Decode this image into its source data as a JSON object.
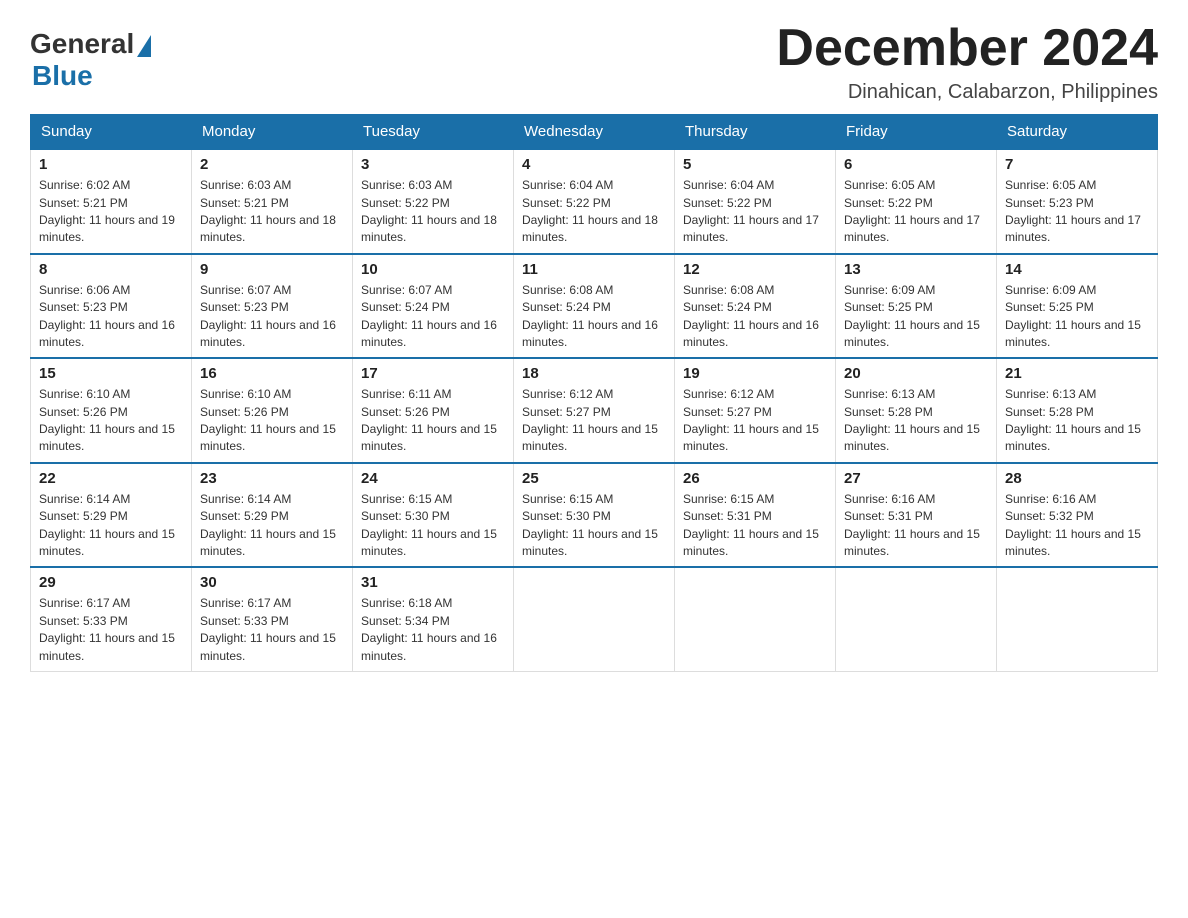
{
  "logo": {
    "general": "General",
    "blue": "Blue"
  },
  "header": {
    "month": "December 2024",
    "location": "Dinahican, Calabarzon, Philippines"
  },
  "days_of_week": [
    "Sunday",
    "Monday",
    "Tuesday",
    "Wednesday",
    "Thursday",
    "Friday",
    "Saturday"
  ],
  "weeks": [
    [
      {
        "day": "1",
        "sunrise": "6:02 AM",
        "sunset": "5:21 PM",
        "daylight": "11 hours and 19 minutes."
      },
      {
        "day": "2",
        "sunrise": "6:03 AM",
        "sunset": "5:21 PM",
        "daylight": "11 hours and 18 minutes."
      },
      {
        "day": "3",
        "sunrise": "6:03 AM",
        "sunset": "5:22 PM",
        "daylight": "11 hours and 18 minutes."
      },
      {
        "day": "4",
        "sunrise": "6:04 AM",
        "sunset": "5:22 PM",
        "daylight": "11 hours and 18 minutes."
      },
      {
        "day": "5",
        "sunrise": "6:04 AM",
        "sunset": "5:22 PM",
        "daylight": "11 hours and 17 minutes."
      },
      {
        "day": "6",
        "sunrise": "6:05 AM",
        "sunset": "5:22 PM",
        "daylight": "11 hours and 17 minutes."
      },
      {
        "day": "7",
        "sunrise": "6:05 AM",
        "sunset": "5:23 PM",
        "daylight": "11 hours and 17 minutes."
      }
    ],
    [
      {
        "day": "8",
        "sunrise": "6:06 AM",
        "sunset": "5:23 PM",
        "daylight": "11 hours and 16 minutes."
      },
      {
        "day": "9",
        "sunrise": "6:07 AM",
        "sunset": "5:23 PM",
        "daylight": "11 hours and 16 minutes."
      },
      {
        "day": "10",
        "sunrise": "6:07 AM",
        "sunset": "5:24 PM",
        "daylight": "11 hours and 16 minutes."
      },
      {
        "day": "11",
        "sunrise": "6:08 AM",
        "sunset": "5:24 PM",
        "daylight": "11 hours and 16 minutes."
      },
      {
        "day": "12",
        "sunrise": "6:08 AM",
        "sunset": "5:24 PM",
        "daylight": "11 hours and 16 minutes."
      },
      {
        "day": "13",
        "sunrise": "6:09 AM",
        "sunset": "5:25 PM",
        "daylight": "11 hours and 15 minutes."
      },
      {
        "day": "14",
        "sunrise": "6:09 AM",
        "sunset": "5:25 PM",
        "daylight": "11 hours and 15 minutes."
      }
    ],
    [
      {
        "day": "15",
        "sunrise": "6:10 AM",
        "sunset": "5:26 PM",
        "daylight": "11 hours and 15 minutes."
      },
      {
        "day": "16",
        "sunrise": "6:10 AM",
        "sunset": "5:26 PM",
        "daylight": "11 hours and 15 minutes."
      },
      {
        "day": "17",
        "sunrise": "6:11 AM",
        "sunset": "5:26 PM",
        "daylight": "11 hours and 15 minutes."
      },
      {
        "day": "18",
        "sunrise": "6:12 AM",
        "sunset": "5:27 PM",
        "daylight": "11 hours and 15 minutes."
      },
      {
        "day": "19",
        "sunrise": "6:12 AM",
        "sunset": "5:27 PM",
        "daylight": "11 hours and 15 minutes."
      },
      {
        "day": "20",
        "sunrise": "6:13 AM",
        "sunset": "5:28 PM",
        "daylight": "11 hours and 15 minutes."
      },
      {
        "day": "21",
        "sunrise": "6:13 AM",
        "sunset": "5:28 PM",
        "daylight": "11 hours and 15 minutes."
      }
    ],
    [
      {
        "day": "22",
        "sunrise": "6:14 AM",
        "sunset": "5:29 PM",
        "daylight": "11 hours and 15 minutes."
      },
      {
        "day": "23",
        "sunrise": "6:14 AM",
        "sunset": "5:29 PM",
        "daylight": "11 hours and 15 minutes."
      },
      {
        "day": "24",
        "sunrise": "6:15 AM",
        "sunset": "5:30 PM",
        "daylight": "11 hours and 15 minutes."
      },
      {
        "day": "25",
        "sunrise": "6:15 AM",
        "sunset": "5:30 PM",
        "daylight": "11 hours and 15 minutes."
      },
      {
        "day": "26",
        "sunrise": "6:15 AM",
        "sunset": "5:31 PM",
        "daylight": "11 hours and 15 minutes."
      },
      {
        "day": "27",
        "sunrise": "6:16 AM",
        "sunset": "5:31 PM",
        "daylight": "11 hours and 15 minutes."
      },
      {
        "day": "28",
        "sunrise": "6:16 AM",
        "sunset": "5:32 PM",
        "daylight": "11 hours and 15 minutes."
      }
    ],
    [
      {
        "day": "29",
        "sunrise": "6:17 AM",
        "sunset": "5:33 PM",
        "daylight": "11 hours and 15 minutes."
      },
      {
        "day": "30",
        "sunrise": "6:17 AM",
        "sunset": "5:33 PM",
        "daylight": "11 hours and 15 minutes."
      },
      {
        "day": "31",
        "sunrise": "6:18 AM",
        "sunset": "5:34 PM",
        "daylight": "11 hours and 16 minutes."
      },
      null,
      null,
      null,
      null
    ]
  ]
}
